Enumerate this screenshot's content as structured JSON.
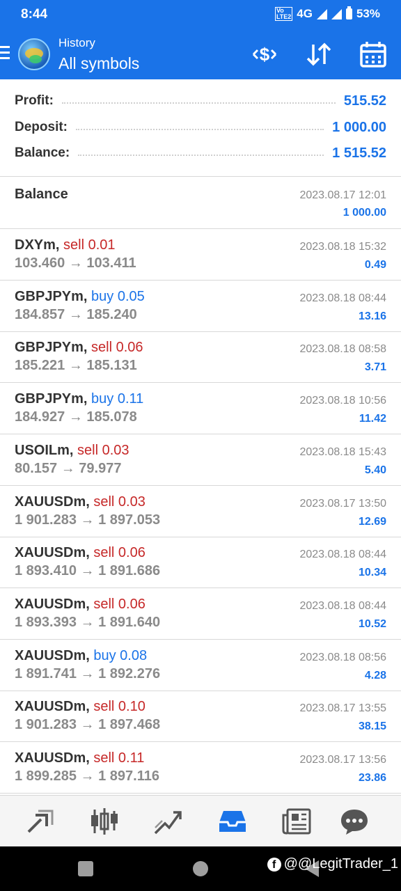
{
  "status_bar": {
    "time": "8:44",
    "volte": "VoLTE2",
    "network": "4G",
    "battery": "53%"
  },
  "app_bar": {
    "subtitle": "History",
    "title": "All symbols"
  },
  "summary": [
    {
      "label": "Profit:",
      "value": "515.52"
    },
    {
      "label": "Deposit:",
      "value": "1 000.00"
    },
    {
      "label": "Balance:",
      "value": "1 515.52"
    }
  ],
  "balance_entry": {
    "label": "Balance",
    "date": "2023.08.17 12:01",
    "value": "1 000.00"
  },
  "trades": [
    {
      "symbol": "DXYm,",
      "side": "sell",
      "action": "sell 0.01",
      "prices": "103.460 → 103.411",
      "date": "2023.08.18 15:32",
      "profit": "0.49"
    },
    {
      "symbol": "GBPJPYm,",
      "side": "buy",
      "action": "buy 0.05",
      "prices": "184.857 → 185.240",
      "date": "2023.08.18 08:44",
      "profit": "13.16"
    },
    {
      "symbol": "GBPJPYm,",
      "side": "sell",
      "action": "sell 0.06",
      "prices": "185.221 → 185.131",
      "date": "2023.08.18 08:58",
      "profit": "3.71"
    },
    {
      "symbol": "GBPJPYm,",
      "side": "buy",
      "action": "buy 0.11",
      "prices": "184.927 → 185.078",
      "date": "2023.08.18 10:56",
      "profit": "11.42"
    },
    {
      "symbol": "USOILm,",
      "side": "sell",
      "action": "sell 0.03",
      "prices": "80.157 → 79.977",
      "date": "2023.08.18 15:43",
      "profit": "5.40"
    },
    {
      "symbol": "XAUUSDm,",
      "side": "sell",
      "action": "sell 0.03",
      "prices": "1 901.283 → 1 897.053",
      "date": "2023.08.17 13:50",
      "profit": "12.69"
    },
    {
      "symbol": "XAUUSDm,",
      "side": "sell",
      "action": "sell 0.06",
      "prices": "1 893.410 → 1 891.686",
      "date": "2023.08.18 08:44",
      "profit": "10.34"
    },
    {
      "symbol": "XAUUSDm,",
      "side": "sell",
      "action": "sell 0.06",
      "prices": "1 893.393 → 1 891.640",
      "date": "2023.08.18 08:44",
      "profit": "10.52"
    },
    {
      "symbol": "XAUUSDm,",
      "side": "buy",
      "action": "buy 0.08",
      "prices": "1 891.741 → 1 892.276",
      "date": "2023.08.18 08:56",
      "profit": "4.28"
    },
    {
      "symbol": "XAUUSDm,",
      "side": "sell",
      "action": "sell 0.10",
      "prices": "1 901.283 → 1 897.468",
      "date": "2023.08.17 13:55",
      "profit": "38.15"
    },
    {
      "symbol": "XAUUSDm,",
      "side": "sell",
      "action": "sell 0.11",
      "prices": "1 899.285 → 1 897.116",
      "date": "2023.08.17 13:56",
      "profit": "23.86"
    }
  ],
  "tabs": [
    {
      "name": "quotes-tab",
      "icon": "quotes-icon"
    },
    {
      "name": "chart-tab",
      "icon": "candlestick-icon"
    },
    {
      "name": "trade-tab",
      "icon": "trade-icon"
    },
    {
      "name": "history-tab",
      "icon": "inbox-icon",
      "active": true
    },
    {
      "name": "news-tab",
      "icon": "news-icon"
    },
    {
      "name": "messages-tab",
      "icon": "chat-icon"
    }
  ],
  "watermark": "@@LegitTrader_1",
  "colors": {
    "accent": "#1a73e8",
    "sell": "#c62828",
    "buy": "#1a73e8",
    "muted": "#8a8a8a"
  }
}
